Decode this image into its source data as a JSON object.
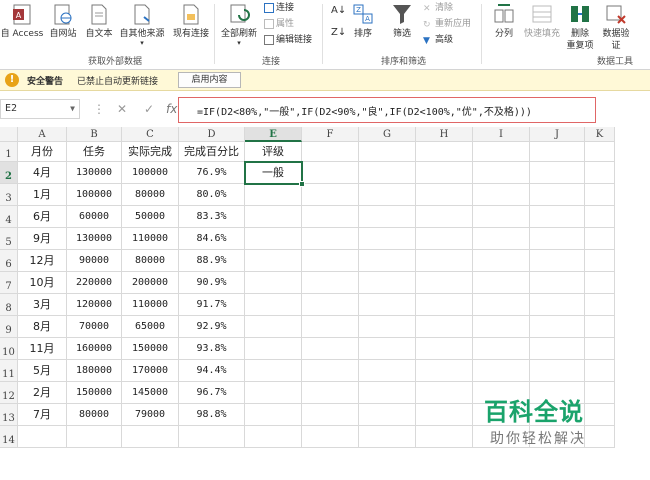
{
  "ribbon": {
    "from_access": "自 Access",
    "from_web": "自网站",
    "from_text": "自文本",
    "from_other": "自其他来源",
    "existing_conn": "现有连接",
    "refresh_all": "全部刷新",
    "connections": "连接",
    "properties": "属性",
    "edit_links": "编辑链接",
    "sort_az": "A↓Z",
    "sort": "排序",
    "filter": "筛选",
    "clear": "清除",
    "reapply": "重新应用",
    "advanced": "高级",
    "text_to_cols": "分列",
    "flash_fill": "快速填充",
    "remove_dup": "删除",
    "remove_dup2": "重复项",
    "data_valid": "数据验",
    "data_valid2": "证",
    "group_get_external": "获取外部数据",
    "group_connections": "连接",
    "group_sort_filter": "排序和筛选",
    "group_data_tools": "数据工具"
  },
  "security": {
    "label": "安全警告",
    "message": "已禁止自动更新链接",
    "button": "启用内容"
  },
  "formula_bar": {
    "name_box": "E2",
    "cancel": "✕",
    "enter": "✓",
    "fx": "fx",
    "formula": "=IF(D2<80%,\"一般\",IF(D2<90%,\"良\",IF(D2<100%,\"优\",不及格)))"
  },
  "sheet": {
    "columns": [
      "A",
      "B",
      "C",
      "D",
      "E",
      "F",
      "G",
      "H",
      "I",
      "J",
      "K"
    ],
    "rows": [
      "1",
      "2",
      "3",
      "4",
      "5",
      "6",
      "7",
      "8",
      "9",
      "10",
      "11",
      "12",
      "13",
      "14"
    ],
    "header": [
      "月份",
      "任务",
      "实际完成",
      "完成百分比",
      "评级"
    ],
    "data": [
      [
        "4月",
        "130000",
        "100000",
        "76.9%",
        "一般"
      ],
      [
        "1月",
        "100000",
        "80000",
        "80.0%",
        ""
      ],
      [
        "6月",
        "60000",
        "50000",
        "83.3%",
        ""
      ],
      [
        "9月",
        "130000",
        "110000",
        "84.6%",
        ""
      ],
      [
        "12月",
        "90000",
        "80000",
        "88.9%",
        ""
      ],
      [
        "10月",
        "220000",
        "200000",
        "90.9%",
        ""
      ],
      [
        "3月",
        "120000",
        "110000",
        "91.7%",
        ""
      ],
      [
        "8月",
        "70000",
        "65000",
        "92.9%",
        ""
      ],
      [
        "11月",
        "160000",
        "150000",
        "93.8%",
        ""
      ],
      [
        "5月",
        "180000",
        "170000",
        "94.4%",
        ""
      ],
      [
        "2月",
        "150000",
        "145000",
        "96.7%",
        ""
      ],
      [
        "7月",
        "80000",
        "79000",
        "98.8%",
        ""
      ]
    ]
  },
  "watermark": {
    "title": "百科全说",
    "subtitle": "助你轻松解决"
  },
  "colors": {
    "accent": "#217346",
    "formula_highlight": "#e06666",
    "watermark": "#1aa36b"
  }
}
